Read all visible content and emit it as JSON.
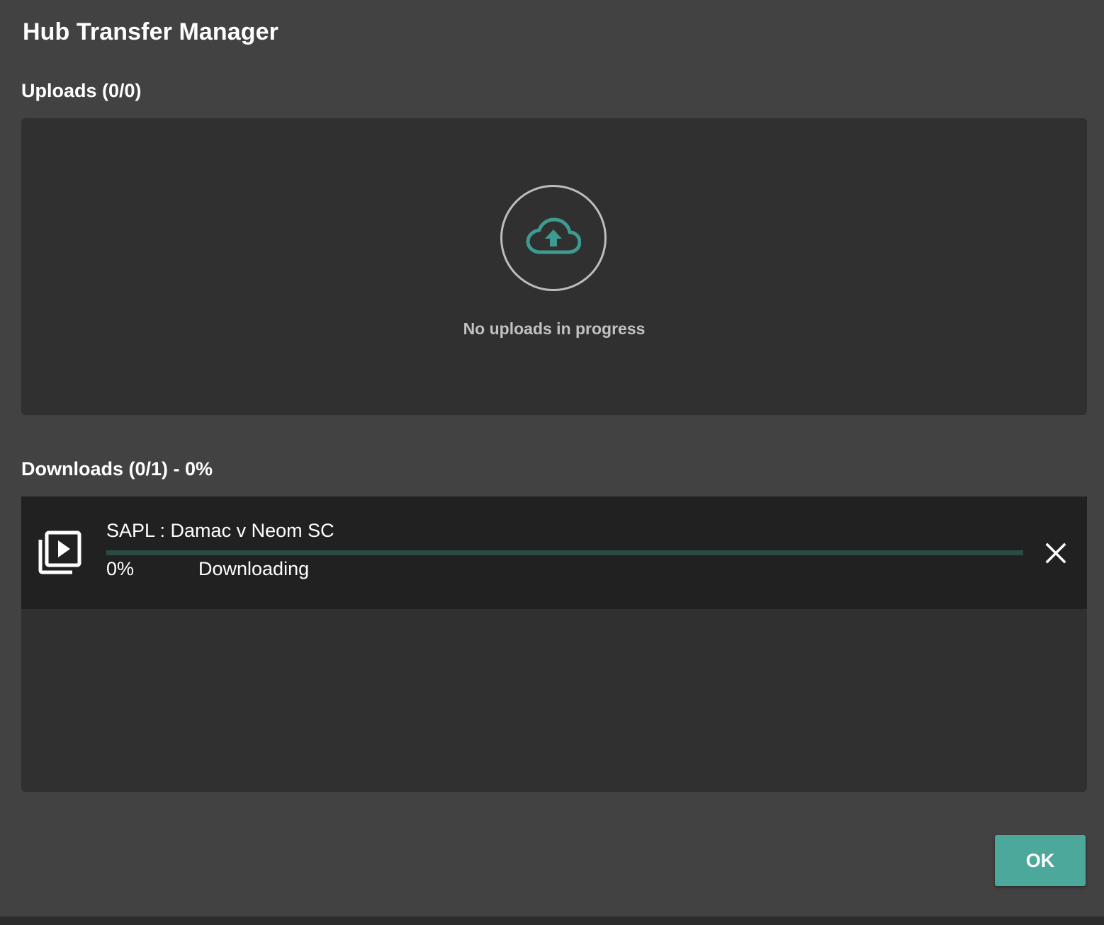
{
  "dialog": {
    "title": "Hub Transfer Manager"
  },
  "uploads": {
    "heading": "Uploads (0/0)",
    "empty_message": "No uploads in progress",
    "icon": "cloud-upload-icon"
  },
  "downloads": {
    "heading": "Downloads (0/1) - 0%",
    "items": [
      {
        "name": "SAPL : Damac v Neom SC",
        "percent_label": "0%",
        "progress": 0,
        "status": "Downloading",
        "icon": "video-library-icon"
      }
    ]
  },
  "footer": {
    "ok_label": "OK"
  },
  "colors": {
    "accent": "#4da89c",
    "dialog_bg": "#424242",
    "panel_bg": "#303030",
    "row_bg": "#212121"
  }
}
